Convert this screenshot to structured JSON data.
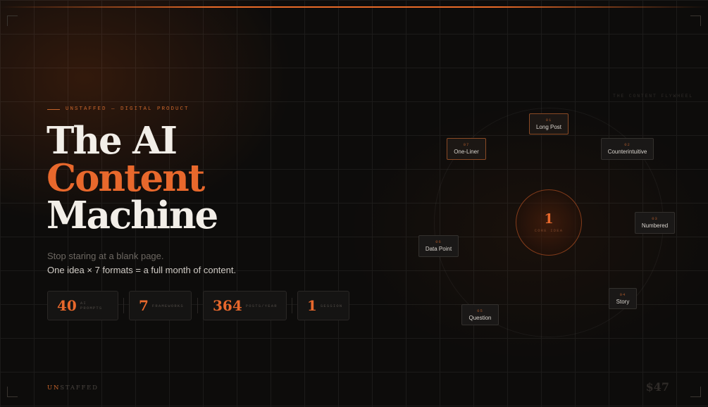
{
  "hero": {
    "eyebrow": "UNSTAFFED — DIGITAL PRODUCT",
    "title_line1": "The AI",
    "title_line2": "Content",
    "title_line3": "Machine",
    "subtitle_line1": "Stop staring at a blank page.",
    "subtitle_line2": "One idea × 7 formats = a full month of content."
  },
  "stats": [
    {
      "value": "40",
      "label": "AI PROMPTS"
    },
    {
      "value": "7",
      "label": "FRAMEWORKS"
    },
    {
      "value": "364",
      "label": "POSTS/YEAR"
    },
    {
      "value": "1",
      "label": "SESSION"
    }
  ],
  "footer": {
    "brand_highlight": "UN",
    "brand_rest": "STAFFED",
    "price": "$47"
  },
  "wheel": {
    "label": "THE CONTENT FLYWHEEL",
    "core_value": "1",
    "core_label": "CORE IDEA",
    "formats": [
      {
        "num": "01",
        "name": "Long Post"
      },
      {
        "num": "02",
        "name": "Counterintuitive"
      },
      {
        "num": "03",
        "name": "Numbered"
      },
      {
        "num": "04",
        "name": "Story"
      },
      {
        "num": "05",
        "name": "Question"
      },
      {
        "num": "06",
        "name": "Data Point"
      },
      {
        "num": "07",
        "name": "One-Liner"
      }
    ]
  },
  "colors": {
    "accent": "#e8682c",
    "background": "#0d0c0b",
    "text": "#f2eee8"
  }
}
